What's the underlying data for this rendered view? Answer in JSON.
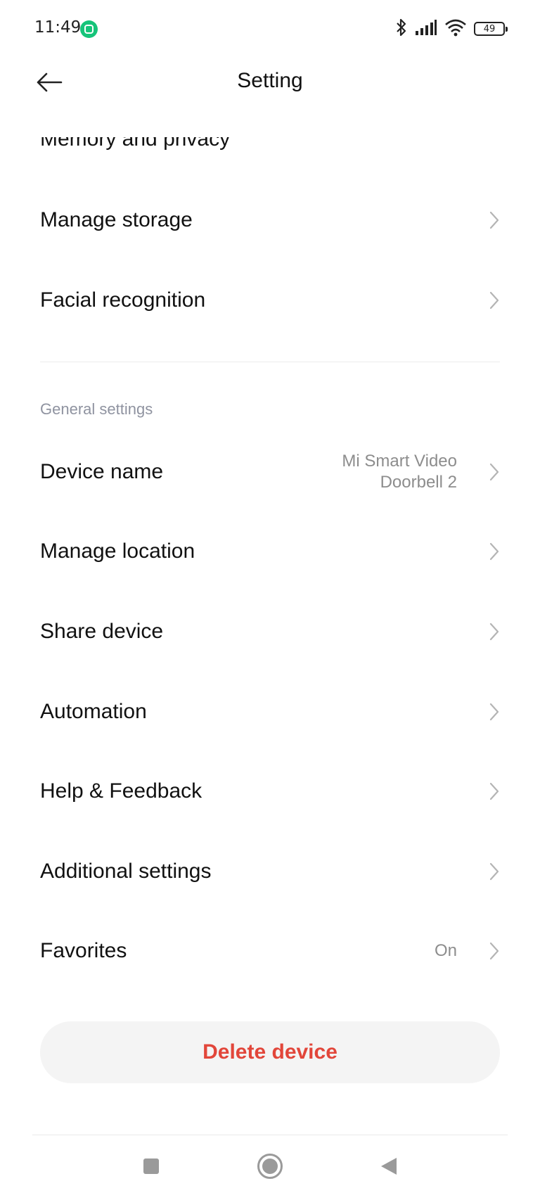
{
  "status_bar": {
    "time": "11:49",
    "battery": "49",
    "icons": [
      "app-badge-icon",
      "bluetooth-icon",
      "signal-icon",
      "wifi-icon",
      "battery-icon"
    ]
  },
  "header": {
    "title": "Setting",
    "back_icon": "back-arrow-icon"
  },
  "partial_row_text": "Memory and privacy",
  "rows_top": [
    {
      "label": "Manage storage"
    },
    {
      "label": "Facial recognition"
    }
  ],
  "general_settings": {
    "header": "General settings",
    "device_name": {
      "label": "Device name",
      "value_line1": "Mi Smart Video",
      "value_line2": "Doorbell 2"
    },
    "rows": [
      {
        "label": "Manage location"
      },
      {
        "label": "Share device"
      },
      {
        "label": "Automation"
      },
      {
        "label": "Help & Feedback"
      },
      {
        "label": "Additional settings"
      }
    ],
    "favorites": {
      "label": "Favorites",
      "value": "On"
    }
  },
  "delete_button": {
    "label": "Delete device",
    "color": "#e2463a"
  },
  "nav_bar": {
    "icons": [
      "recents-square-icon",
      "home-circle-icon",
      "back-triangle-icon"
    ]
  }
}
